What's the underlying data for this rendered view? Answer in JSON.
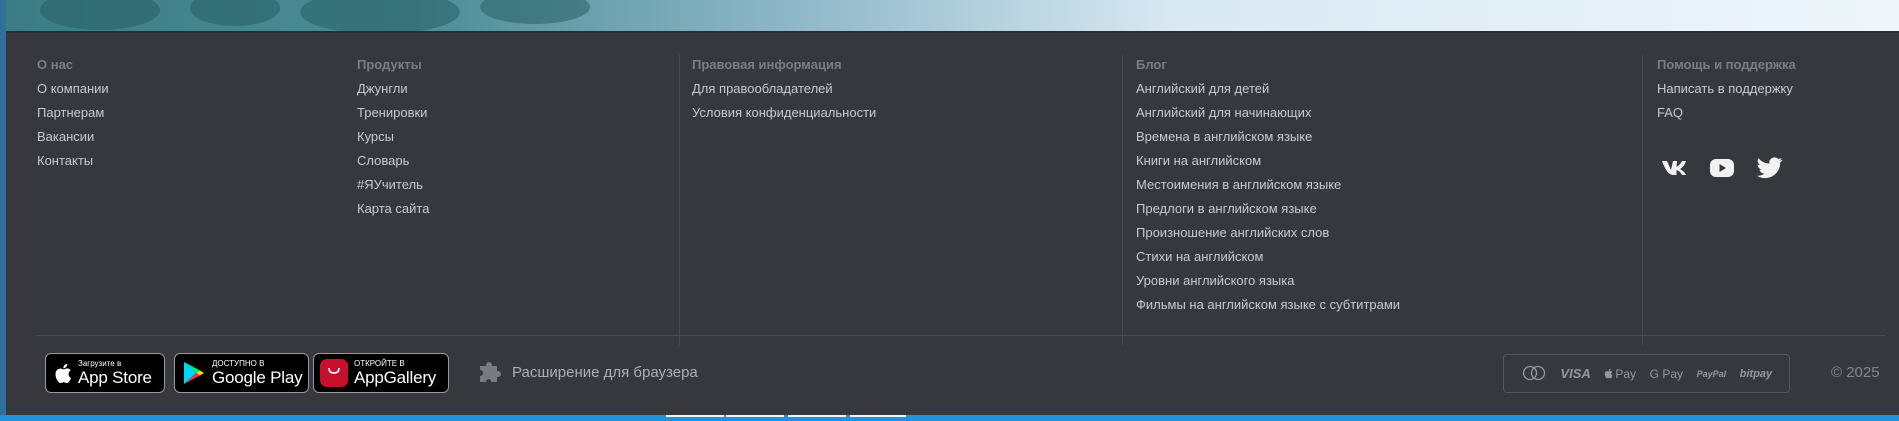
{
  "columns": [
    {
      "title": "О нас",
      "links": [
        "О компании",
        "Партнерам",
        "Вакансии",
        "Контакты"
      ]
    },
    {
      "title": "Продукты",
      "links": [
        "Джунгли",
        "Тренировки",
        "Курсы",
        "Словарь",
        "#ЯУчитель",
        "Карта сайта"
      ]
    },
    {
      "title": "Правовая информация",
      "links": [
        "Для правообладателей",
        "Условия конфиденциальности"
      ]
    },
    {
      "title": "Блог",
      "links": [
        "Английский для детей",
        "Английский для начинающих",
        "Времена в английском языке",
        "Книги на английском",
        "Местоимения в английском языке",
        "Предлоги в английском языке",
        "Произношение английских слов",
        "Стихи на английском",
        "Уровни английского языка",
        "Фильмы на английском языке с субтитрами"
      ]
    },
    {
      "title": "Помощь и поддержка",
      "links": [
        "Написать в поддержку",
        "FAQ"
      ]
    }
  ],
  "socials": [
    {
      "name": "vk-icon"
    },
    {
      "name": "youtube-icon"
    },
    {
      "name": "twitter-icon"
    }
  ],
  "stores": [
    {
      "small": "Загрузите в",
      "big": "App Store"
    },
    {
      "small": "ДОСТУПНО В",
      "big": "Google Play"
    },
    {
      "small": "ОТКРОЙТЕ В",
      "big": "AppGallery",
      "badge": "HUAWEI"
    }
  ],
  "extension": {
    "label": "Расширение для браузера"
  },
  "payments": [
    "VISA",
    "Pay",
    "G Pay",
    "PayPal",
    "bitpay"
  ],
  "copyright": "© 2025",
  "colors": {
    "footer_bg": "#37383d",
    "link": "#c9cace",
    "title": "#7c7d83",
    "accent_blue": "#2392dc"
  }
}
